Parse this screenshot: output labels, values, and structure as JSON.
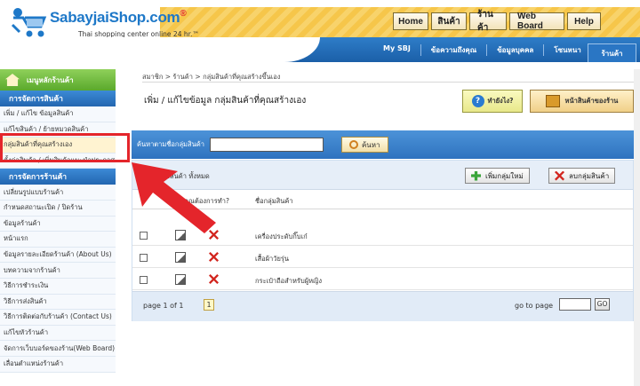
{
  "logo": {
    "brand": "SabayjaiShop.com",
    "reg": "®",
    "tagline": "Thai shopping center online 24 hr.™"
  },
  "topnav": [
    "Home",
    "สินค้า",
    "ร้านค้า",
    "Web Board",
    "Help"
  ],
  "subnav": [
    "My SBJ",
    "ข้อความถึงคุณ",
    "ข้อมูลบุคคล",
    "โซนหนา"
  ],
  "subnav_active": "ร้านค้า",
  "sidebar": {
    "home": "เมนูหลักร้านค้า",
    "section1": "การจัดการสินค้า",
    "items1": [
      "เพิ่ม / แก้ไข ข้อมูลสินค้า",
      "แก้ไขสินค้า / ย้ายหมวดสินค้า",
      "กลุ่มสินค้าที่คุณสร้างเอง",
      "ตั้งค่าสินค้า / เพิ่มสินค้าแนะนำประกาศ"
    ],
    "section2": "การจัดการร้านค้า",
    "items2": [
      "เปลี่ยนรูปแบบร้านค้า",
      "กำหนดสถานะเปิด / ปิดร้าน",
      "ข้อมูลร้านค้า",
      "หน้าแรก",
      "ข้อมูลรายละเอียดร้านค้า (About Us)",
      "บทความจากร้านค้า",
      "วิธีการชำระเงิน",
      "วิธีการส่งสินค้า",
      "วิธีการติดต่อกับร้านค้า (Contact Us)",
      "แก้ไขหัวร้านค้า",
      "จัดการเว็บบอร์ดของร้าน(Web Board)",
      "เลื่อนตำแหน่งร้านค้า"
    ]
  },
  "breadcrumb": "สมาชิก > ร้านค้า > กลุ่มสินค้าที่คุณสร้างขึ้นเอง",
  "page_title": "เพิ่ม / แก้ไขข้อมูล กลุ่มสินค้าที่คุณสร้างเอง",
  "help_button": "ทำยังไง?",
  "store_button": "หน้าสินค้าของร้าน",
  "search": {
    "label": "ค้นหาตามชื่อกลุ่มสินค้า",
    "value": "",
    "button": "ค้นหา"
  },
  "list": {
    "count_label": "กลุ่มสินค้า ทั้งหมด",
    "add_button": "เพิ่มกลุ่มใหม่",
    "delete_button": "ลบกลุ่มสินค้า",
    "col_action": "คุณต้องการทำ?",
    "col_name": "ชื่อกลุ่มสินค้า",
    "rows": [
      "เครื่องประดับกิ๊บเก๋",
      "เสื้อผ้าวัยรุ่น",
      "กระเป๋าถือสำหรับผู้หญิง"
    ]
  },
  "pager": {
    "info": "page 1 of 1",
    "current": "1",
    "goto_label": "go to page",
    "go_button": "GO"
  },
  "colors": {
    "highlight": "#e4252b",
    "blue": "#2e72bf",
    "green": "#5aa92c"
  }
}
